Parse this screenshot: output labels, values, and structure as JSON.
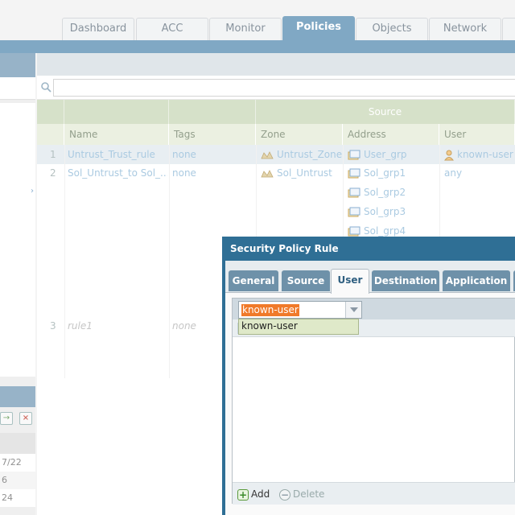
{
  "nav": {
    "tabs": [
      {
        "label": "Dashboard"
      },
      {
        "label": "ACC"
      },
      {
        "label": "Monitor"
      },
      {
        "label": "Policies"
      },
      {
        "label": "Objects"
      },
      {
        "label": "Network"
      }
    ],
    "active": "Policies"
  },
  "grid": {
    "group_source": "Source",
    "columns": [
      "Name",
      "Tags",
      "Zone",
      "Address",
      "User"
    ],
    "rows": [
      {
        "num": "1",
        "name": "Untrust_Trust_rule",
        "tags": "none",
        "zone": "Untrust_Zone",
        "address": [
          "User_grp"
        ],
        "user": "known-user"
      },
      {
        "num": "2",
        "name": "Sol_Untrust_to Sol_...",
        "tags": "none",
        "zone": "Sol_Untrust",
        "address": [
          "Sol_grp1",
          "Sol_grp2",
          "Sol_grp3",
          "Sol_grp4"
        ],
        "user": "any"
      },
      {
        "num": "3",
        "name": "rule1",
        "tags": "none"
      }
    ]
  },
  "sidebar": {
    "rows": [
      "7/22",
      "6",
      "24"
    ]
  },
  "dialog": {
    "title": "Security Policy Rule",
    "tabs": [
      "General",
      "Source",
      "User",
      "Destination",
      "Application"
    ],
    "active_tab": "User",
    "combo_value": "known-user",
    "dropdown_option": "known-user",
    "add_label": "Add",
    "delete_label": "Delete"
  },
  "colors": {
    "nav_active": "#4f87ad",
    "dialog_frame": "#2f6f95",
    "selection": "#f07a2a",
    "link": "#8ab6d6"
  }
}
